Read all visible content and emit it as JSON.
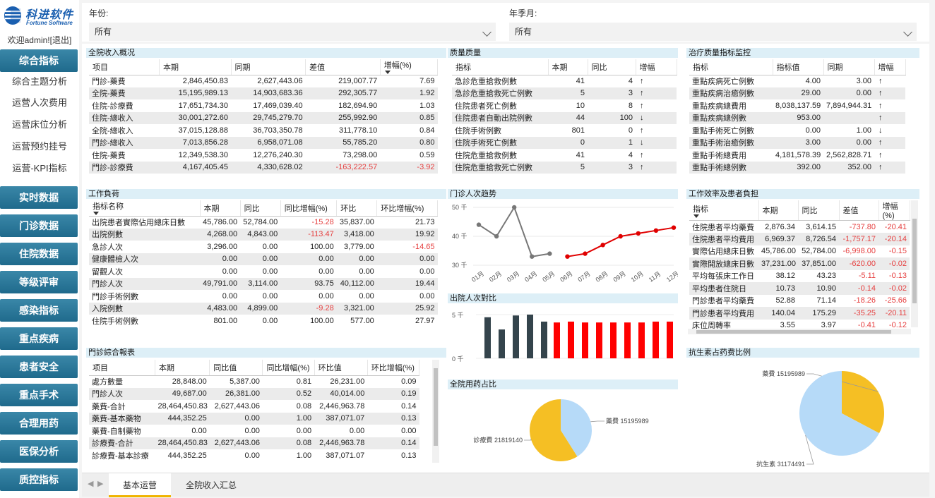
{
  "logo": {
    "cn": "科进软件",
    "en": "Fortune Software"
  },
  "welcome": {
    "prefix": "欢迎admin!",
    "open": "[",
    "logout": "退出",
    "close": "]"
  },
  "nav": {
    "section1": "综合指标",
    "sub": [
      "综合主题分析",
      "运营人次费用",
      "运营床位分析",
      "运营预约挂号",
      "运营-KPI指标"
    ],
    "items": [
      "实时数据",
      "门诊数据",
      "住院数据",
      "等级评审",
      "感染指标",
      "重点疾病",
      "患者安全",
      "重点手术",
      "合理用药",
      "医保分析",
      "质控指标"
    ]
  },
  "filters": {
    "year_label": "年份:",
    "year_value": "所有",
    "quarter_label": "年季月:",
    "quarter_value": "所有"
  },
  "income": {
    "title": "全院收入概况",
    "headers": [
      "项目",
      "本期",
      "同期",
      "差值",
      "增幅(%)"
    ],
    "rows": [
      [
        "門診-藥費",
        "2,846,450.83",
        "2,627,443.06",
        "219,007.77",
        "7.69"
      ],
      [
        "全院-藥費",
        "15,195,989.13",
        "14,903,683.36",
        "292,305.77",
        "1.92"
      ],
      [
        "住院-診療費",
        "17,651,734.30",
        "17,469,039.40",
        "182,694.90",
        "1.03"
      ],
      [
        "住院-總收入",
        "30,001,272.60",
        "29,745,279.70",
        "255,992.90",
        "0.85"
      ],
      [
        "全院-總收入",
        "37,015,128.88",
        "36,703,350.78",
        "311,778.10",
        "0.84"
      ],
      [
        "門診-總收入",
        "7,013,856.28",
        "6,958,071.08",
        "55,785.20",
        "0.80"
      ],
      [
        "住院-藥費",
        "12,349,538.30",
        "12,276,240.30",
        "73,298.00",
        "0.59"
      ],
      [
        "門診-診療費",
        "4,167,405.45",
        "4,330,628.02",
        "-163,222.57",
        "-3.92"
      ]
    ]
  },
  "quality": {
    "title": "质量质量",
    "headers": [
      "指标",
      "本期",
      "同比",
      "增幅"
    ],
    "rows": [
      [
        "急診危重搶救例數",
        "41",
        "4",
        "↑"
      ],
      [
        "急診危重搶救死亡例數",
        "5",
        "3",
        "↑"
      ],
      [
        "住院患者死亡例數",
        "10",
        "8",
        "↑"
      ],
      [
        "住院患者自動出院例數",
        "44",
        "100",
        "↓"
      ],
      [
        "住院手術例數",
        "801",
        "0",
        "↑"
      ],
      [
        "住院手術死亡例數",
        "0",
        "1",
        "↓"
      ],
      [
        "住院危重搶救例數",
        "41",
        "4",
        "↑"
      ],
      [
        "住院危重搶救死亡例數",
        "5",
        "3",
        "↑"
      ]
    ]
  },
  "treatment": {
    "title": "治疗质量指标监控",
    "headers": [
      "指标",
      "指标值",
      "同期",
      "增幅"
    ],
    "rows": [
      [
        "重點疾病死亡例數",
        "4.00",
        "3.00",
        "↑"
      ],
      [
        "重點疾病治癒例數",
        "29.00",
        "0.00",
        "↑"
      ],
      [
        "重點疾病總費用",
        "8,038,137.59",
        "7,894,944.31",
        "↑"
      ],
      [
        "重點疾病總例數",
        "953.00",
        "",
        "↑"
      ],
      [
        "重點手術死亡例數",
        "0.00",
        "1.00",
        "↓"
      ],
      [
        "重點手術治癒例數",
        "3.00",
        "0.00",
        "↑"
      ],
      [
        "重點手術總費用",
        "4,181,578.39",
        "2,562,828.71",
        "↑"
      ],
      [
        "重點手術總例數",
        "392.00",
        "352.00",
        "↑"
      ]
    ]
  },
  "workload": {
    "title": "工作負荷",
    "headers": [
      "指标名称",
      "本期",
      "同比",
      "同比增幅(%)",
      "环比",
      "环比增幅(%)"
    ],
    "rows": [
      [
        "出院患者實際佔用總床日數",
        "45,786.00",
        "52,784.00",
        "-15.28",
        "35,837.00",
        "21.73"
      ],
      [
        "出院例數",
        "4,268.00",
        "4,843.00",
        "-113.47",
        "3,418.00",
        "19.92"
      ],
      [
        "急診人次",
        "3,296.00",
        "0.00",
        "100.00",
        "3,779.00",
        "-14.65"
      ],
      [
        "健康體檢人次",
        "0.00",
        "0.00",
        "0.00",
        "0.00",
        "0.00"
      ],
      [
        "留觀人次",
        "0.00",
        "0.00",
        "0.00",
        "0.00",
        "0.00"
      ],
      [
        "門診人次",
        "49,791.00",
        "3,114.00",
        "93.75",
        "40,112.00",
        "19.44"
      ],
      [
        "門診手術例數",
        "0.00",
        "0.00",
        "0.00",
        "0.00",
        "0.00"
      ],
      [
        "入院例數",
        "4,483.00",
        "4,899.00",
        "-9.28",
        "3,321.00",
        "25.92"
      ],
      [
        "住院手術例數",
        "801.00",
        "0.00",
        "100.00",
        "577.00",
        "27.97"
      ]
    ]
  },
  "opreport": {
    "title": "門診綜合報表",
    "headers": [
      "项目",
      "本期",
      "同比值",
      "同比增幅(%)",
      "环比值",
      "环比增幅(%)"
    ],
    "rows": [
      [
        "處方數量",
        "28,848.00",
        "5,387.00",
        "0.81",
        "26,231.00",
        "0.09"
      ],
      [
        "門診人次",
        "49,687.00",
        "26,381.00",
        "0.52",
        "40,014.00",
        "0.19"
      ],
      [
        "藥費-合計",
        "28,464,450.83",
        "2,627,443.06",
        "0.08",
        "2,446,963.78",
        "0.14"
      ],
      [
        "藥費-基本藥物",
        "444,352.25",
        "0.00",
        "1.00",
        "387,071.07",
        "0.13"
      ],
      [
        "藥費-自制藥物",
        "0.00",
        "0.00",
        "0.00",
        "0.00",
        "0.00"
      ],
      [
        "診療費-合計",
        "28,464,450.83",
        "2,627,443.06",
        "0.08",
        "2,446,963.78",
        "0.14"
      ],
      [
        "診療費-基本診療",
        "444,352.25",
        "0.00",
        "1.00",
        "387,071.07",
        "0.13"
      ]
    ]
  },
  "efficiency": {
    "title": "工作效率及患者負担",
    "headers": [
      "指标",
      "本期",
      "同比",
      "差值",
      "增幅(%)"
    ],
    "rows": [
      [
        "住院患者平均藥費",
        "2,876.34",
        "3,614.15",
        "-737.80",
        "-20.41"
      ],
      [
        "住院患者平均費用",
        "6,969.37",
        "8,726.54",
        "-1,757.17",
        "-20.14"
      ],
      [
        "實際佔用總床日數",
        "45,786.00",
        "52,784.00",
        "-6,998.00",
        "-0.15"
      ],
      [
        "實際開放總床日數",
        "37,231.00",
        "37,851.00",
        "-620.00",
        "-0.02"
      ],
      [
        "平均每張床工作日",
        "38.12",
        "43.23",
        "-5.11",
        "-0.13"
      ],
      [
        "平均患者住院日",
        "10.73",
        "10.90",
        "-0.14",
        "-0.02"
      ],
      [
        "門診患者平均藥費",
        "52.88",
        "71.14",
        "-18.26",
        "-25.66"
      ],
      [
        "門診患者平均費用",
        "140.04",
        "175.29",
        "-35.25",
        "-20.11"
      ],
      [
        "床位周轉率",
        "3.55",
        "3.97",
        "-0.41",
        "-0.12"
      ]
    ]
  },
  "tabs": [
    "基本运营",
    "全院收入汇总"
  ],
  "colors": {
    "accent": "#f0b400",
    "nav": "#2a7b9d",
    "negative": "#e64040",
    "line_red": "#e00000",
    "line_gray": "#777777",
    "bar_dark": "#34444c",
    "bar_red": "#ff0000",
    "pie_yellow": "#f5bf24",
    "pie_blue": "#b6daf8"
  },
  "chart_data": [
    {
      "type": "line",
      "title": "门诊人次趋势",
      "categories": [
        "01月",
        "02月",
        "03月",
        "04月",
        "05月",
        "06月",
        "07月",
        "08月",
        "09月",
        "10月",
        "11月",
        "12月"
      ],
      "series": [
        {
          "values": [
            44,
            40,
            50,
            33,
            34,
            null,
            null,
            null,
            null,
            null,
            null,
            null
          ]
        },
        {
          "values": [
            null,
            null,
            null,
            null,
            null,
            33,
            34,
            37,
            40,
            41,
            42,
            43
          ]
        }
      ],
      "yticks": [
        "30 千",
        "40 千",
        "50 千"
      ],
      "ylim": [
        30,
        50
      ]
    },
    {
      "type": "bar",
      "title": "出院人次對比",
      "series": [
        {
          "values": [
            4.7,
            3.3,
            4.9,
            5.0,
            4.2
          ]
        },
        {
          "values": [
            4.1,
            4.2,
            4.1,
            4.1,
            4.1,
            4.1,
            4.1,
            4.2,
            4.2
          ]
        }
      ],
      "yticks": [
        "5 千",
        "0 千"
      ],
      "ylim": [
        0,
        5
      ]
    },
    {
      "type": "pie",
      "title": "全院用药占比",
      "slices": [
        {
          "label": "藥費",
          "value": 15195989
        },
        {
          "label": "診療費",
          "value": 21819140
        }
      ]
    },
    {
      "type": "pie",
      "title": "抗生素占药费比例",
      "slices": [
        {
          "label": "藥費",
          "value": 15195989
        },
        {
          "label": "抗生素",
          "value": 31174491
        }
      ]
    }
  ]
}
